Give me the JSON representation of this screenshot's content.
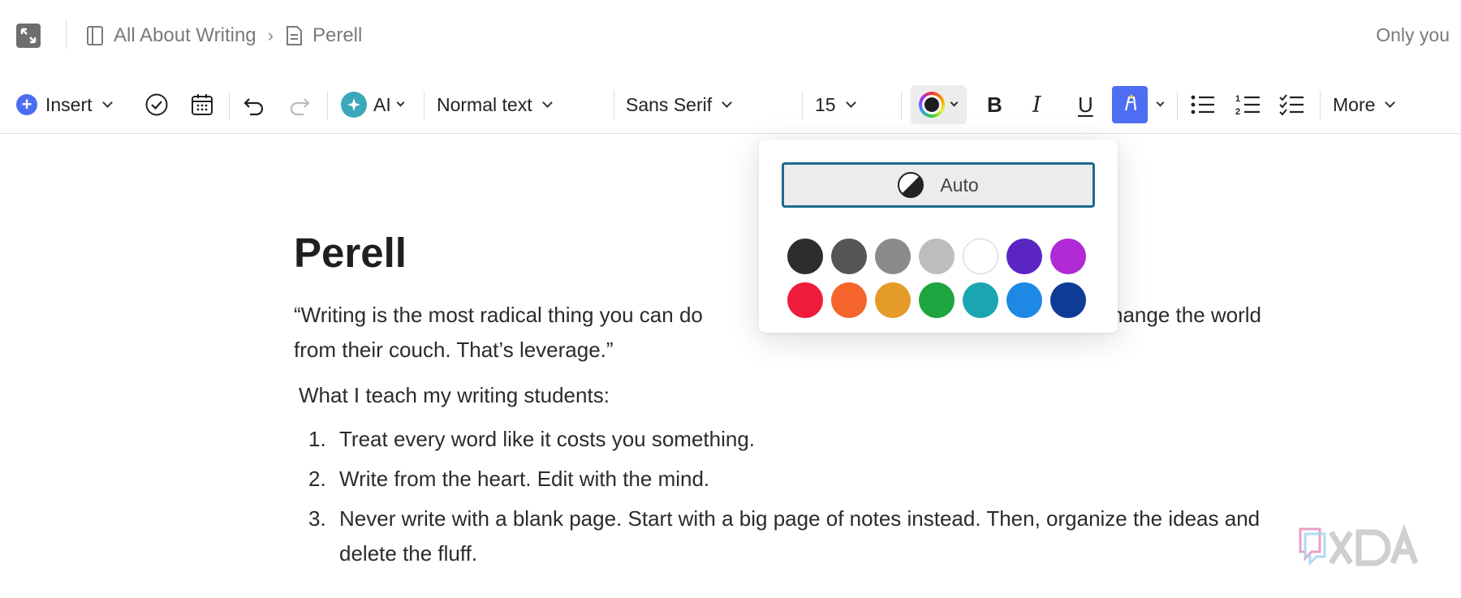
{
  "topbar": {
    "breadcrumb_parent": "All About Writing",
    "breadcrumb_current": "Perell",
    "share_status": "Only you"
  },
  "toolbar": {
    "insert_label": "Insert",
    "ai_label": "AI",
    "text_style": "Normal text",
    "font_family": "Sans Serif",
    "font_size": "15",
    "more_label": "More"
  },
  "document": {
    "title": "Perell",
    "quote_visible": "“Writing is the most radical thing you can do",
    "quote_right": "hange the world",
    "quote_line2": "from their couch. That’s leverage.”",
    "intro": "What I teach my writing students:",
    "list": [
      {
        "num": "1.",
        "text": "Treat every word like it costs you something."
      },
      {
        "num": "2.",
        "text": "Write from the heart. Edit with the mind."
      },
      {
        "num": "3.",
        "text": "Never write with a blank page. Start with a big page of notes instead. Then, organize the ideas and delete the fluff."
      }
    ]
  },
  "color_picker": {
    "auto_label": "Auto",
    "swatches": [
      "#2d2d2d",
      "#555555",
      "#8a8a8a",
      "#bdbdbd",
      "#ffffff",
      "#5b25c3",
      "#b02ad6",
      "#ee1c3a",
      "#f5652b",
      "#e49b27",
      "#1fa540",
      "#1aa6b0",
      "#1e88e5",
      "#0d3b96"
    ],
    "focus_border": "#1f6a8f"
  },
  "watermark": {
    "brand": "XDA"
  },
  "colors": {
    "accent": "#4d6ef2"
  }
}
